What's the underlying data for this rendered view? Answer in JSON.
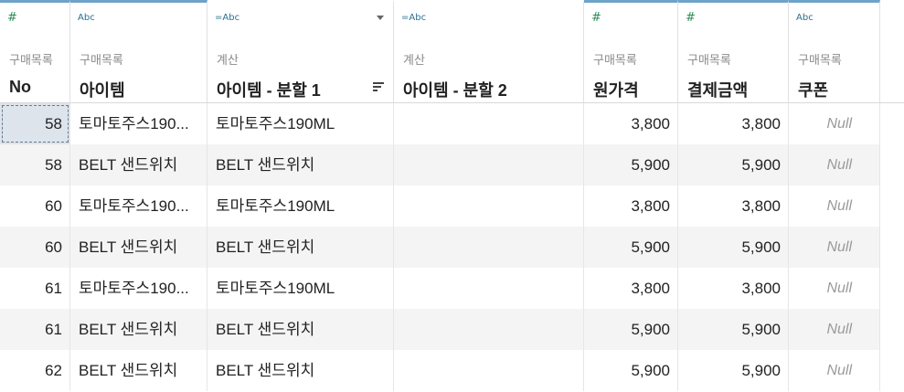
{
  "columns": [
    {
      "key": "no",
      "type_icon": "#",
      "source": "구매목록",
      "name": "No"
    },
    {
      "key": "item",
      "type_icon": "Abc",
      "source": "구매목록",
      "name": "아이템"
    },
    {
      "key": "split1",
      "type_icon": "=Abc",
      "source": "계산",
      "name": "아이템 - 분할 1"
    },
    {
      "key": "split2",
      "type_icon": "=Abc",
      "source": "계산",
      "name": "아이템 - 분할 2"
    },
    {
      "key": "price",
      "type_icon": "#",
      "source": "구매목록",
      "name": "원가격"
    },
    {
      "key": "paid",
      "type_icon": "#",
      "source": "구매목록",
      "name": "결제금액"
    },
    {
      "key": "coupon",
      "type_icon": "Abc",
      "source": "구매목록",
      "name": "쿠폰"
    }
  ],
  "rows": [
    {
      "no": "58",
      "item": "토마토주스190...",
      "split1": "토마토주스190ML",
      "split2": "",
      "price": "3,800",
      "paid": "3,800",
      "coupon": "Null"
    },
    {
      "no": "58",
      "item": "BELT 샌드위치",
      "split1": "BELT 샌드위치",
      "split2": "",
      "price": "5,900",
      "paid": "5,900",
      "coupon": "Null"
    },
    {
      "no": "60",
      "item": "토마토주스190...",
      "split1": "토마토주스190ML",
      "split2": "",
      "price": "3,800",
      "paid": "3,800",
      "coupon": "Null"
    },
    {
      "no": "60",
      "item": "BELT 샌드위치",
      "split1": "BELT 샌드위치",
      "split2": "",
      "price": "5,900",
      "paid": "5,900",
      "coupon": "Null"
    },
    {
      "no": "61",
      "item": "토마토주스190...",
      "split1": "토마토주스190ML",
      "split2": "",
      "price": "3,800",
      "paid": "3,800",
      "coupon": "Null"
    },
    {
      "no": "61",
      "item": "BELT 샌드위치",
      "split1": "BELT 샌드위치",
      "split2": "",
      "price": "5,900",
      "paid": "5,900",
      "coupon": "Null"
    },
    {
      "no": "62",
      "item": "BELT 샌드위치",
      "split1": "BELT 샌드위치",
      "split2": "",
      "price": "5,900",
      "paid": "5,900",
      "coupon": "Null"
    }
  ]
}
